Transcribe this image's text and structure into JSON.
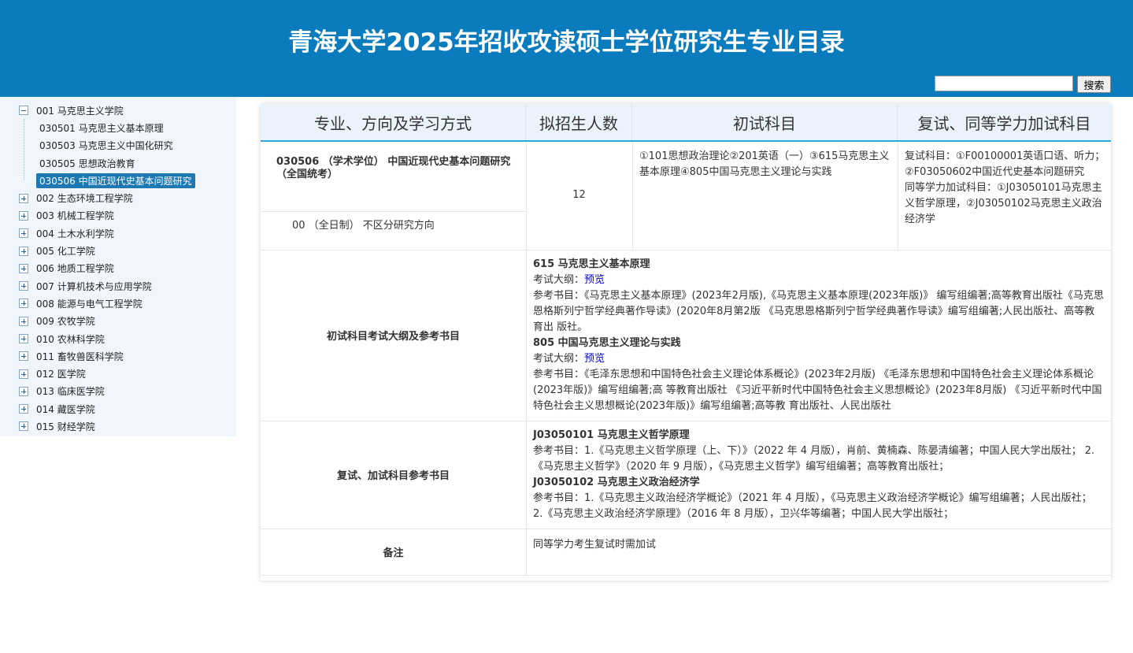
{
  "header": {
    "title": "青海大学2025年招收攻读硕士学位研究生专业目录",
    "search_button": "搜索",
    "search_value": ""
  },
  "sidebar": {
    "expanded": {
      "label": "001 马克思主义学院",
      "children": [
        "030501 马克思主义基本原理",
        "030503 马克思主义中国化研究",
        "030505 思想政治教育",
        "030506 中国近现代史基本问题研究"
      ],
      "selected_index": 3
    },
    "collapsed": [
      "002 生态环境工程学院",
      "003 机械工程学院",
      "004 土木水利学院",
      "005 化工学院",
      "006 地质工程学院",
      "007 计算机技术与应用学院",
      "008 能源与电气工程学院",
      "009 农牧学院",
      "010 农林科学院",
      "011 畜牧兽医科学院",
      "012 医学院",
      "013 临床医学院",
      "014 藏医学院",
      "015 财经学院"
    ]
  },
  "table": {
    "headers": [
      "专业、方向及学习方式",
      "拟招生人数",
      "初试科目",
      "复试、同等学力加试科目"
    ],
    "major": "030506 （学术学位） 中国近现代史基本问题研究（全国统考）",
    "direction": "00 （全日制） 不区分研究方向",
    "enrollment": "12",
    "initial_subjects": "①101思想政治理论②201英语（一）③615马克思主义基本原理④805中国马克思主义理论与实践",
    "retest_line1": "复试科目：①F00100001英语口语、听力；②F03050602中国近代史基本问题研究",
    "retest_line2": "同等学力加试科目：①J03050101马克思主义哲学原理，②J03050102马克思主义政治经济学",
    "syllabus_label": "初试科目考试大纲及参考书目",
    "s1_title": "615 马克思主义基本原理",
    "outline_prefix": "考试大纲：",
    "preview_link": "预览",
    "s1_refs": "参考书目：《马克思主义基本原理》(2023年2月版),《马克思主义基本原理(2023年版)》 编写组编著;高等教育出版社《马克思恩格斯列宁哲学经典著作导读》(2020年8月第2版 《马克思恩格斯列宁哲学经典著作导读》编写组编著;人民出版社、高等教育出 版社。",
    "s2_title": "805 中国马克思主义理论与实践",
    "s2_refs": "参考书目：《毛泽东思想和中国特色社会主义理论体系概论》(2023年2月版) 《毛泽东思想和中国特色社会主义理论体系概论(2023年版)》编写组编著;高 等教育出版社 《习近平新时代中国特色社会主义思想概论》(2023年8月版) 《习近平新时代中国特色社会主义思想概论(2023年版)》编写组编著;高等教 育出版社、人民出版社",
    "retest_label": "复试、加试科目参考书目",
    "r1_title": "J03050101 马克思主义哲学原理",
    "r1_refs": "参考书目：1.《马克思主义哲学原理（上、下）》（2022 年 4 月版），肖前、黄楠森、陈晏清编著；中国人民大学出版社； 2.《马克思主义哲学》（2020 年 9 月版），《马克思主义哲学》编写组编著；高等教育出版社；",
    "r2_title": "J03050102 马克思主义政治经济学",
    "r2_refs": "参考书目：1.《马克思主义政治经济学概论》（2021 年 4 月版），《马克思主义政治经济学概论》编写组编著；人民出版社； 2.《马克思主义政治经济学原理》（2016 年 8 月版），卫兴华等编著；中国人民大学出版社；",
    "remark_label": "备注",
    "remark": "同等学力考生复试时需加试"
  }
}
